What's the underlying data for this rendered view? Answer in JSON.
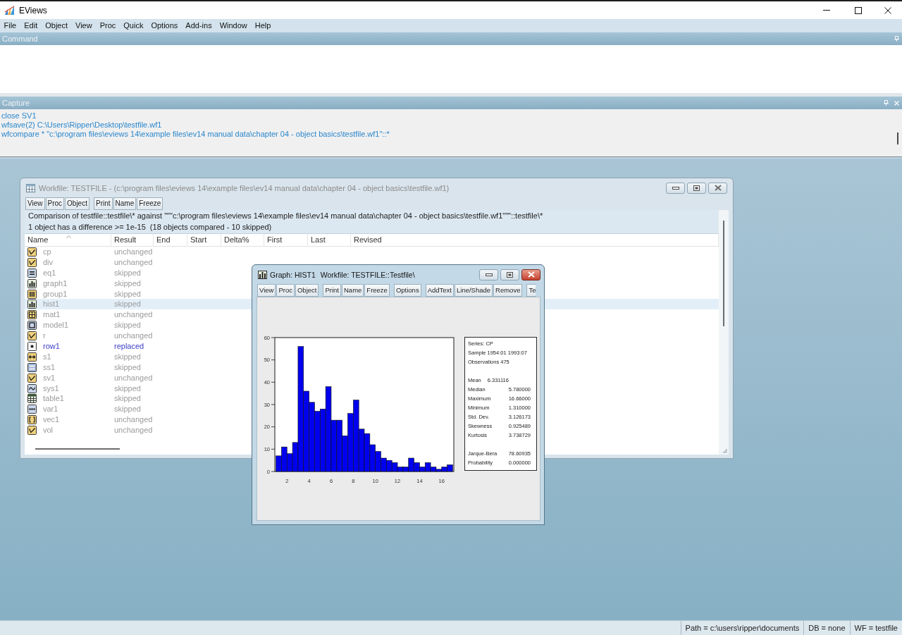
{
  "app": {
    "title": "EViews"
  },
  "menu": [
    "File",
    "Edit",
    "Object",
    "View",
    "Proc",
    "Quick",
    "Options",
    "Add-ins",
    "Window",
    "Help"
  ],
  "command_pane": {
    "title": "Command"
  },
  "capture_pane": {
    "title": "Capture",
    "lines": [
      "close SV1",
      "wfsave(2) C:\\Users\\Ripper\\Desktop\\testfile.wf1",
      "wfcompare * \"c:\\program files\\eviews 14\\example files\\ev14 manual data\\chapter 04 - object basics\\testfile.wf1\"::*"
    ]
  },
  "workfile_window": {
    "title": "Workfile: TESTFILE - (c:\\program files\\eviews 14\\example files\\ev14 manual data\\chapter 04 - object basics\\testfile.wf1)",
    "active": false,
    "toolbar": [
      [
        "View",
        "Proc",
        "Object"
      ],
      [
        "Print",
        "Name",
        "Freeze"
      ]
    ],
    "summary": [
      "Comparison of testfile::testfile\\* against \"\"\"c:\\program files\\eviews 14\\example files\\ev14 manual data\\chapter 04 - object basics\\testfile.wf1\"\"\"::testfile\\*",
      "1 object has a difference >= 1e-15  (18 objects compared - 10 skipped)"
    ],
    "columns": [
      "Name",
      "Result",
      "End",
      "Start",
      "Delta%",
      "First",
      "Last",
      "Revised"
    ],
    "rows": [
      {
        "kind": "series",
        "name": "cp",
        "result": "unchanged",
        "changed": false,
        "selected": false
      },
      {
        "kind": "series",
        "name": "div",
        "result": "unchanged",
        "changed": false,
        "selected": false
      },
      {
        "kind": "equation",
        "name": "eq1",
        "result": "skipped",
        "changed": false,
        "selected": false
      },
      {
        "kind": "graph",
        "name": "graph1",
        "result": "skipped",
        "changed": false,
        "selected": false
      },
      {
        "kind": "group",
        "name": "group1",
        "result": "skipped",
        "changed": false,
        "selected": false
      },
      {
        "kind": "graph",
        "name": "hist1",
        "result": "skipped",
        "changed": false,
        "selected": true
      },
      {
        "kind": "matrix",
        "name": "mat1",
        "result": "unchanged",
        "changed": false,
        "selected": false
      },
      {
        "kind": "model",
        "name": "model1",
        "result": "skipped",
        "changed": false,
        "selected": false
      },
      {
        "kind": "series",
        "name": "r",
        "result": "unchanged",
        "changed": false,
        "selected": false
      },
      {
        "kind": "unknown",
        "name": "row1",
        "result": "replaced",
        "changed": true,
        "selected": false
      },
      {
        "kind": "sample",
        "name": "s1",
        "result": "skipped",
        "changed": false,
        "selected": false
      },
      {
        "kind": "sspace",
        "name": "ss1",
        "result": "skipped",
        "changed": false,
        "selected": false
      },
      {
        "kind": "series",
        "name": "sv1",
        "result": "unchanged",
        "changed": false,
        "selected": false
      },
      {
        "kind": "system",
        "name": "sys1",
        "result": "skipped",
        "changed": false,
        "selected": false
      },
      {
        "kind": "table",
        "name": "table1",
        "result": "skipped",
        "changed": false,
        "selected": false
      },
      {
        "kind": "var",
        "name": "var1",
        "result": "skipped",
        "changed": false,
        "selected": false
      },
      {
        "kind": "vector",
        "name": "vec1",
        "result": "unchanged",
        "changed": false,
        "selected": false
      },
      {
        "kind": "series",
        "name": "vol",
        "result": "unchanged",
        "changed": false,
        "selected": false
      }
    ]
  },
  "graph_window": {
    "title": "Graph: HIST1",
    "workfile": "Workfile: TESTFILE::Testfile\\",
    "active": true,
    "toolbar": [
      [
        "View",
        "Proc",
        "Object"
      ],
      [
        "Print",
        "Name",
        "Freeze"
      ],
      [
        "Options"
      ],
      [
        "AddText",
        "Line/Shade",
        "Remove"
      ],
      [
        "Te"
      ]
    ],
    "chart_data": {
      "type": "bar",
      "x": [
        1.25,
        1.75,
        2.25,
        2.75,
        3.25,
        3.75,
        4.25,
        4.75,
        5.25,
        5.75,
        6.25,
        6.75,
        7.25,
        7.75,
        8.25,
        8.75,
        9.25,
        9.75,
        10.25,
        10.75,
        11.25,
        11.75,
        12.25,
        12.75,
        13.25,
        13.75,
        14.25,
        14.75,
        15.25,
        15.75,
        16.25,
        16.75
      ],
      "values": [
        7,
        11,
        8,
        13,
        56,
        36,
        31,
        27,
        28,
        38,
        23,
        23,
        16,
        26,
        32,
        19,
        17,
        12,
        9,
        6,
        5,
        4,
        2,
        2,
        6,
        4,
        2,
        4,
        2,
        1,
        2,
        3
      ],
      "xlim": [
        0.9,
        17.1
      ],
      "ylim": [
        0,
        60
      ],
      "xticks": [
        2,
        4,
        6,
        8,
        10,
        12,
        14,
        16
      ],
      "yticks": [
        0,
        10,
        20,
        30,
        40,
        50,
        60
      ]
    },
    "statistics": [
      [
        {
          "kind": "line",
          "text": "Series: CP"
        },
        {
          "kind": "line",
          "text": "Sample 1954:01 1993:07"
        },
        {
          "kind": "line",
          "text": "Observations 475"
        }
      ],
      [
        {
          "kind": "inline",
          "label": "Mean",
          "value": "6.331116"
        },
        {
          "kind": "pair",
          "label": "Median",
          "value": "5.780000"
        },
        {
          "kind": "pair",
          "label": "Maximum",
          "value": "16.66000"
        },
        {
          "kind": "pair",
          "label": "Minimum",
          "value": "1.310000"
        },
        {
          "kind": "pair",
          "label": "Std. Dev.",
          "value": "3.126173"
        },
        {
          "kind": "pair",
          "label": "Skewness",
          "value": "0.925489"
        },
        {
          "kind": "pair",
          "label": "Kurtosis",
          "value": "3.738729"
        }
      ],
      [
        {
          "kind": "pair",
          "label": "Jarque-Bera",
          "value": "78.60935"
        },
        {
          "kind": "pair",
          "label": "Probability",
          "value": "0.000000"
        }
      ]
    ]
  },
  "status_bar": [
    "Path = c:\\users\\ripper\\documents",
    "DB = none",
    "WF = testfile"
  ]
}
